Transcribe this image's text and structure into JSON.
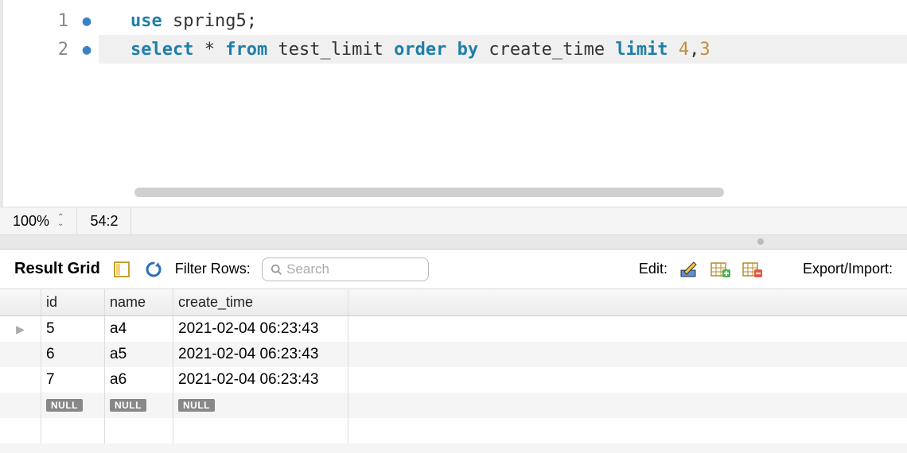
{
  "editor": {
    "lines": [
      {
        "num": "1",
        "tokens": [
          "use",
          " spring5",
          ";"
        ]
      },
      {
        "num": "2",
        "tokens": [
          "select",
          " * ",
          "from",
          " test_limit ",
          "order by",
          " create_time ",
          "limit",
          " ",
          "4",
          ",",
          "3"
        ]
      }
    ]
  },
  "status": {
    "zoom": "100%",
    "position": "54:2"
  },
  "toolbar": {
    "result_grid": "Result Grid",
    "filter_rows": "Filter Rows:",
    "search_placeholder": "Search",
    "edit": "Edit:",
    "export_import": "Export/Import:"
  },
  "grid": {
    "columns": [
      "id",
      "name",
      "create_time"
    ],
    "rows": [
      {
        "id": "5",
        "name": "a4",
        "create_time": "2021-02-04 06:23:43",
        "active": true
      },
      {
        "id": "6",
        "name": "a5",
        "create_time": "2021-02-04 06:23:43",
        "active": false
      },
      {
        "id": "7",
        "name": "a6",
        "create_time": "2021-02-04 06:23:43",
        "active": false
      }
    ],
    "null_label": "NULL"
  }
}
